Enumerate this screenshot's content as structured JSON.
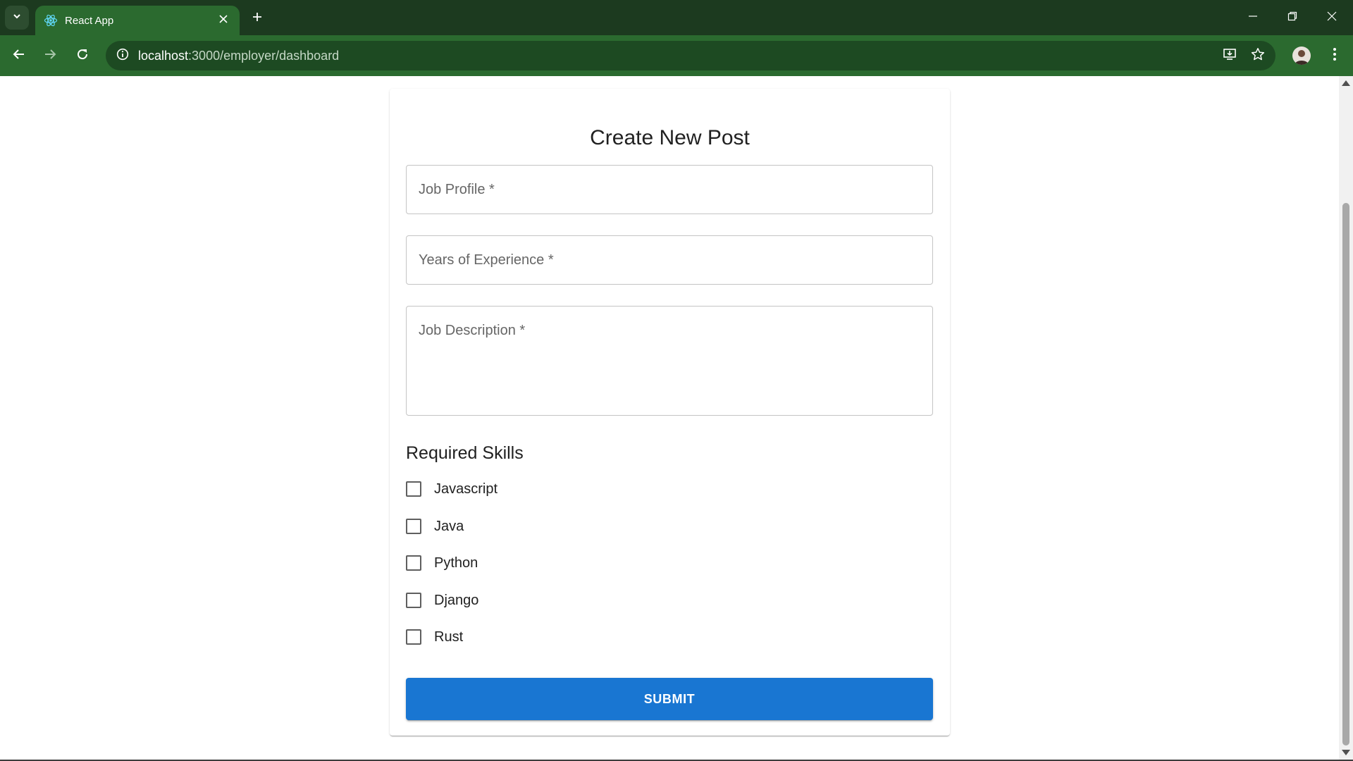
{
  "browser": {
    "tab": {
      "title": "React App",
      "favicon": "react-logo-icon"
    },
    "url": {
      "host": "localhost",
      "rest": ":3000/employer/dashboard"
    },
    "icons": {
      "tab_search": "chevron-down-icon",
      "tab_close": "close-icon",
      "new_tab": "plus-icon",
      "minimize": "minimize-icon",
      "restore": "restore-icon",
      "close_window": "close-icon",
      "back": "back-arrow-icon",
      "forward": "forward-arrow-icon",
      "reload": "reload-icon",
      "site_info": "info-icon",
      "install_app": "install-app-icon",
      "bookmark": "star-icon",
      "menu": "kebab-menu-icon"
    },
    "colors": {
      "tabstrip": "#1c3a1f",
      "toolbar": "#2b6a2f",
      "omnibox": "#1d4a22"
    }
  },
  "form": {
    "title": "Create New Post",
    "fields": [
      {
        "label": "Job Profile *",
        "type": "text",
        "value": ""
      },
      {
        "label": "Years of Experience *",
        "type": "text",
        "value": ""
      },
      {
        "label": "Job Description *",
        "type": "textarea",
        "value": ""
      }
    ],
    "skills": {
      "title": "Required Skills",
      "options": [
        {
          "label": "Javascript",
          "checked": false
        },
        {
          "label": "Java",
          "checked": false
        },
        {
          "label": "Python",
          "checked": false
        },
        {
          "label": "Django",
          "checked": false
        },
        {
          "label": "Rust",
          "checked": false
        }
      ]
    },
    "submit_label": "SUBMIT",
    "colors": {
      "primary": "#1976d2",
      "border": "#c4c4c4"
    }
  }
}
